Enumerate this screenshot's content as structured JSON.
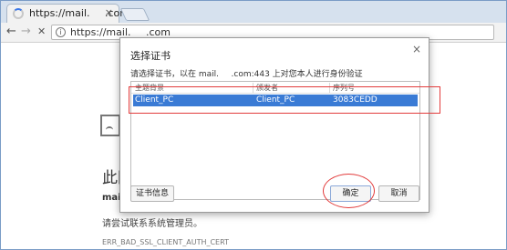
{
  "browser": {
    "tab_title": "https://mail.   .com",
    "tab_close": "×",
    "url": "https://mail.   .com",
    "nav_back": "←",
    "nav_forward": "→",
    "nav_stop": "✕",
    "info": "i"
  },
  "page": {
    "heading": "此网",
    "domain": "mail",
    "advice": "请尝试联系系统管理员。",
    "error_code": "ERR_BAD_SSL_CLIENT_AUTH_CERT"
  },
  "dialog": {
    "title": "选择证书",
    "close": "×",
    "description": "请选择证书，以在 mail.   .com:443 上对您本人进行身份验证",
    "columns": [
      "主题背景",
      "颁发者",
      "序列号"
    ],
    "rows": [
      {
        "subject": "Client_PC",
        "issuer": "Client_PC",
        "serial": "3083CEDD",
        "selected": true
      }
    ],
    "buttons": {
      "cert_info": "证书信息",
      "ok": "确定",
      "cancel": "取消"
    }
  },
  "annotations": {
    "color": "#e23b3b"
  }
}
